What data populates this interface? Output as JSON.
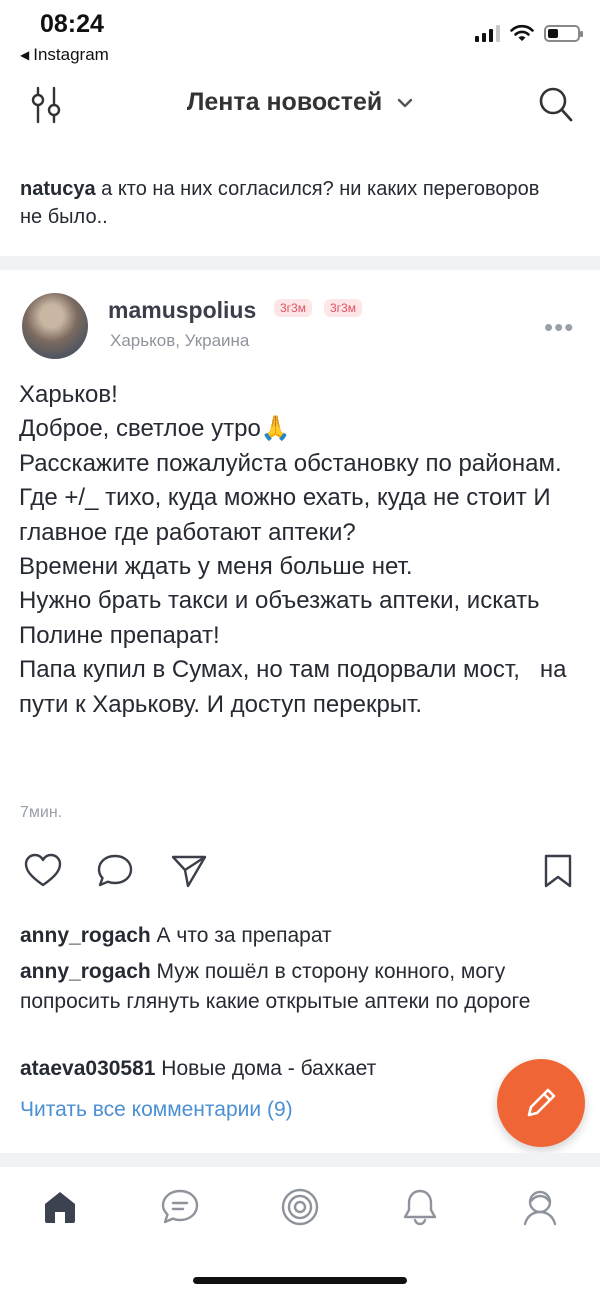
{
  "status_bar": {
    "time": "08:24",
    "back_app": "Instagram"
  },
  "header": {
    "title": "Лента новостей"
  },
  "prev_comment": {
    "user": "natucya",
    "text": " а кто на  них согласился? ни каких переговоров не было.."
  },
  "post": {
    "username": "mamuspolius",
    "badges": [
      "3г3м",
      "3г3м"
    ],
    "location": "Харьков, Украина",
    "text": "Харьков!\nДоброе, светлое утро🙏\nРасскажите пожалуйста обстановку по районам.\nГде +/_ тихо, куда можно ехать, куда не стоит И главное где работают аптеки?\nВремени ждать у меня больше нет.\nНужно брать такси и объезжать аптеки, искать Полине препарат!\nПапа купил в Сумах, но там подорвали мост,   на пути к Харькову. И доступ перекрыт.",
    "time": "7мин."
  },
  "comments": [
    {
      "user": "anny_rogach",
      "text": " А что за препарат"
    },
    {
      "user": "anny_rogach",
      "text": " Муж пошёл в сторону конного, могу попросить глянуть какие открытые аптеки по дороге"
    },
    {
      "user": "ataeva030581",
      "text": " Новые дома - бахкает"
    }
  ],
  "read_all_comments": "Читать все комментарии (9)",
  "colors": {
    "accent_fab": "#f06535",
    "link": "#4b8fd4",
    "badge": "#e0525e",
    "text": "#262a33"
  },
  "icons": {
    "header": [
      "filter-icon",
      "search-icon"
    ],
    "actions": [
      "heart-icon",
      "comment-icon",
      "share-icon",
      "bookmark-icon"
    ],
    "tabs": [
      "home-icon",
      "chat-icon",
      "target-icon",
      "bell-icon",
      "profile-icon"
    ],
    "fab": "pencil-icon"
  }
}
